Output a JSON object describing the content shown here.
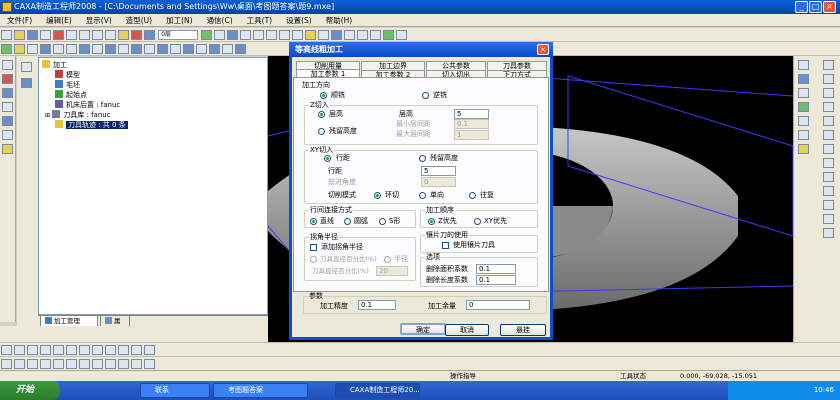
{
  "window": {
    "title": "CAXA制造工程师2008 - [C:\\Documents and Settings\\Ww\\桌面\\考图题答案\\题9.mxe]",
    "min": "_",
    "max": "□",
    "close": "×"
  },
  "menu": [
    "文件(F)",
    "编辑(E)",
    "显示(V)",
    "造型(U)",
    "加工(N)",
    "通信(C)",
    "工具(T)",
    "设置(S)",
    "帮助(H)"
  ],
  "toolbar": {
    "layer_select": "0层",
    "color_select": ""
  },
  "tree": {
    "root": "加工",
    "items": [
      "模型",
      "毛坯",
      "起始点",
      "机床后置 : fanuc",
      "刀具库 : fanuc"
    ],
    "selected": "刀具轨迹 : 共 0 条",
    "tabs": [
      "加工管理",
      "属"
    ]
  },
  "dialog": {
    "title": "等高线粗加工",
    "close": "×",
    "tabs_top": [
      "切削用量",
      "加工边界",
      "公共参数",
      "刀具参数"
    ],
    "tabs_bottom": [
      "加工参数 1",
      "加工参数 2",
      "切入切出",
      "下刀方式"
    ],
    "direction": {
      "title": "加工方向",
      "opt1": "顺铣",
      "opt2": "逆铣"
    },
    "z_cut": {
      "title": "Z切入",
      "opt_height": "层高",
      "opt_residual": "残留高度",
      "height_label": "层高",
      "height_value": "5",
      "min_height_label": "最小层间距",
      "min_height_value": "0.1",
      "max_height_label": "最大层间距",
      "max_height_value": "1"
    },
    "xy_cut": {
      "title": "XY切入",
      "opt_pitch": "行距",
      "opt_residual": "残留高度",
      "pitch_label": "行距",
      "pitch_value": "5",
      "angle_label": "前进角度",
      "angle_value": "0",
      "mode_label": "切削模式",
      "mode_loop": "环切",
      "mode_one": "单向",
      "mode_back": "往复"
    },
    "row_connect": {
      "title": "行间连接方式",
      "opt_line": "直线",
      "opt_arc": "圆弧",
      "opt_s": "S形"
    },
    "order": {
      "title": "加工顺序",
      "opt_z": "Z优先",
      "opt_xy": "XY优先"
    },
    "corner": {
      "title": "拐角半径",
      "add_label": "添加拐角半径",
      "ratio_label": "刀具直径百分比(%)",
      "radius_label": "半径",
      "pct_label": "刀具直径百分比(%)",
      "pct_value": "20"
    },
    "insert": {
      "title": "镶片刀的使用",
      "label": "使用镶片刀具"
    },
    "options": {
      "title": "选项",
      "area_label": "删除面积系数",
      "area_value": "0.1",
      "length_label": "删除长度系数",
      "length_value": "0.1"
    },
    "params": {
      "title": "参数",
      "precision_label": "加工精度",
      "precision_value": "0.1",
      "allowance_label": "加工余量",
      "allowance_value": "0"
    },
    "buttons": {
      "ok": "确定",
      "cancel": "取消",
      "hang": "悬挂"
    }
  },
  "status": {
    "prompt": "操作指导",
    "tool_status": "工具状态",
    "coords": "0.000, -69.028, -15.051"
  },
  "taskbar": {
    "start": "开始",
    "items": [
      "联系",
      "考图题答案",
      "CAXA制造工程师20..."
    ],
    "clock": "10:46"
  }
}
